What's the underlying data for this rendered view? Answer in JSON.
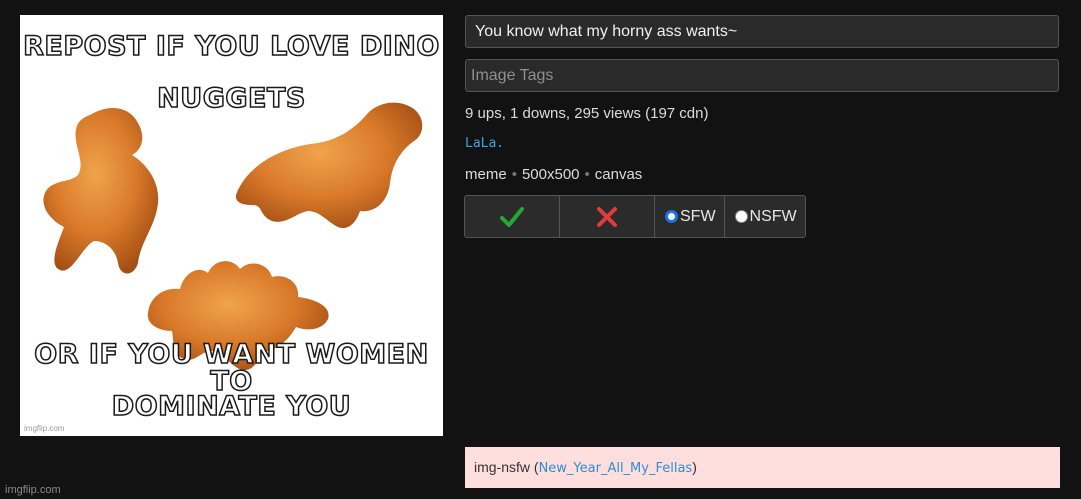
{
  "meme": {
    "top_line_1": "REPOST IF YOU LOVE DINO",
    "top_line_2": "NUGGETS",
    "bottom_line_1": "OR IF YOU WANT WOMEN TO",
    "bottom_line_2": "DOMINATE YOU",
    "watermark": "imgflip.com"
  },
  "title_value": "You know what my horny ass wants~",
  "tags_placeholder": "Image Tags",
  "stats": "9 ups, 1 downs, 295 views (197 cdn)",
  "username": "LaLa.",
  "meta": {
    "type": "meme",
    "dimensions": "500x500",
    "renderer": "canvas"
  },
  "actions": {
    "approve_icon": "check-icon",
    "reject_icon": "x-icon",
    "sfw_label": "SFW",
    "nsfw_label": "NSFW",
    "selected": "SFW"
  },
  "flag": {
    "prefix": "img-nsfw (",
    "stream": "New_Year_All_My_Fellas",
    "suffix": ")"
  },
  "footer_watermark": "imgflip.com",
  "colors": {
    "background": "#121212",
    "link": "#3fa4e0",
    "approve": "#22aa33",
    "reject": "#e23b3b",
    "flag_bg": "#ffdede"
  }
}
